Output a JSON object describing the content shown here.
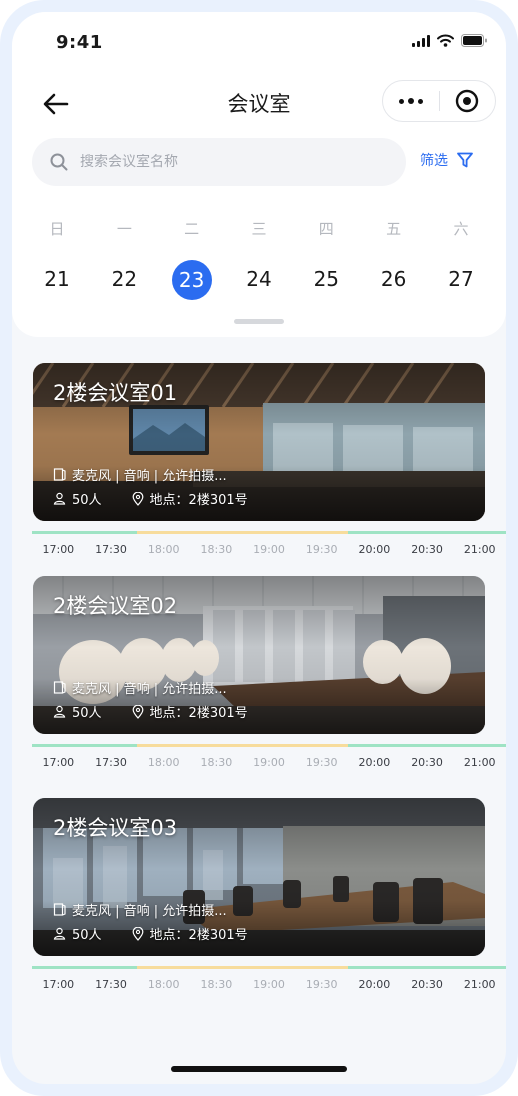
{
  "status_bar": {
    "time": "9:41"
  },
  "nav": {
    "title": "会议室"
  },
  "search": {
    "placeholder": "搜索会议室名称",
    "filter_label": "筛选"
  },
  "calendar": {
    "weekdays": [
      "日",
      "一",
      "二",
      "三",
      "四",
      "五",
      "六"
    ],
    "dates": [
      "21",
      "22",
      "23",
      "24",
      "25",
      "26",
      "27"
    ],
    "selected_date": "23"
  },
  "colors": {
    "accent": "#2b6cf0",
    "slot_free": "#9ee3c4",
    "slot_busy": "#f7dc9c"
  },
  "rooms": [
    {
      "name": "2楼会议室01",
      "equipment": "麦克风 | 音响 | 允许拍摄...",
      "capacity": "50人",
      "location": "地点：2楼301号",
      "slots": [
        {
          "time": "17:00",
          "status": "free"
        },
        {
          "time": "17:30",
          "status": "free"
        },
        {
          "time": "18:00",
          "status": "busy"
        },
        {
          "time": "18:30",
          "status": "busy"
        },
        {
          "time": "19:00",
          "status": "busy"
        },
        {
          "time": "19:30",
          "status": "busy"
        },
        {
          "time": "20:00",
          "status": "free"
        },
        {
          "time": "20:30",
          "status": "free"
        },
        {
          "time": "21:00",
          "status": "free"
        }
      ]
    },
    {
      "name": "2楼会议室02",
      "equipment": "麦克风 | 音响 | 允许拍摄...",
      "capacity": "50人",
      "location": "地点：2楼301号",
      "slots": [
        {
          "time": "17:00",
          "status": "free"
        },
        {
          "time": "17:30",
          "status": "free"
        },
        {
          "time": "18:00",
          "status": "busy"
        },
        {
          "time": "18:30",
          "status": "busy"
        },
        {
          "time": "19:00",
          "status": "busy"
        },
        {
          "time": "19:30",
          "status": "busy"
        },
        {
          "time": "20:00",
          "status": "free"
        },
        {
          "time": "20:30",
          "status": "free"
        },
        {
          "time": "21:00",
          "status": "free"
        }
      ]
    },
    {
      "name": "2楼会议室03",
      "equipment": "麦克风 | 音响 | 允许拍摄...",
      "capacity": "50人",
      "location": "地点：2楼301号",
      "slots": [
        {
          "time": "17:00",
          "status": "free"
        },
        {
          "time": "17:30",
          "status": "free"
        },
        {
          "time": "18:00",
          "status": "busy"
        },
        {
          "time": "18:30",
          "status": "busy"
        },
        {
          "time": "19:00",
          "status": "busy"
        },
        {
          "time": "19:30",
          "status": "busy"
        },
        {
          "time": "20:00",
          "status": "free"
        },
        {
          "time": "20:30",
          "status": "free"
        },
        {
          "time": "21:00",
          "status": "free"
        }
      ]
    }
  ]
}
